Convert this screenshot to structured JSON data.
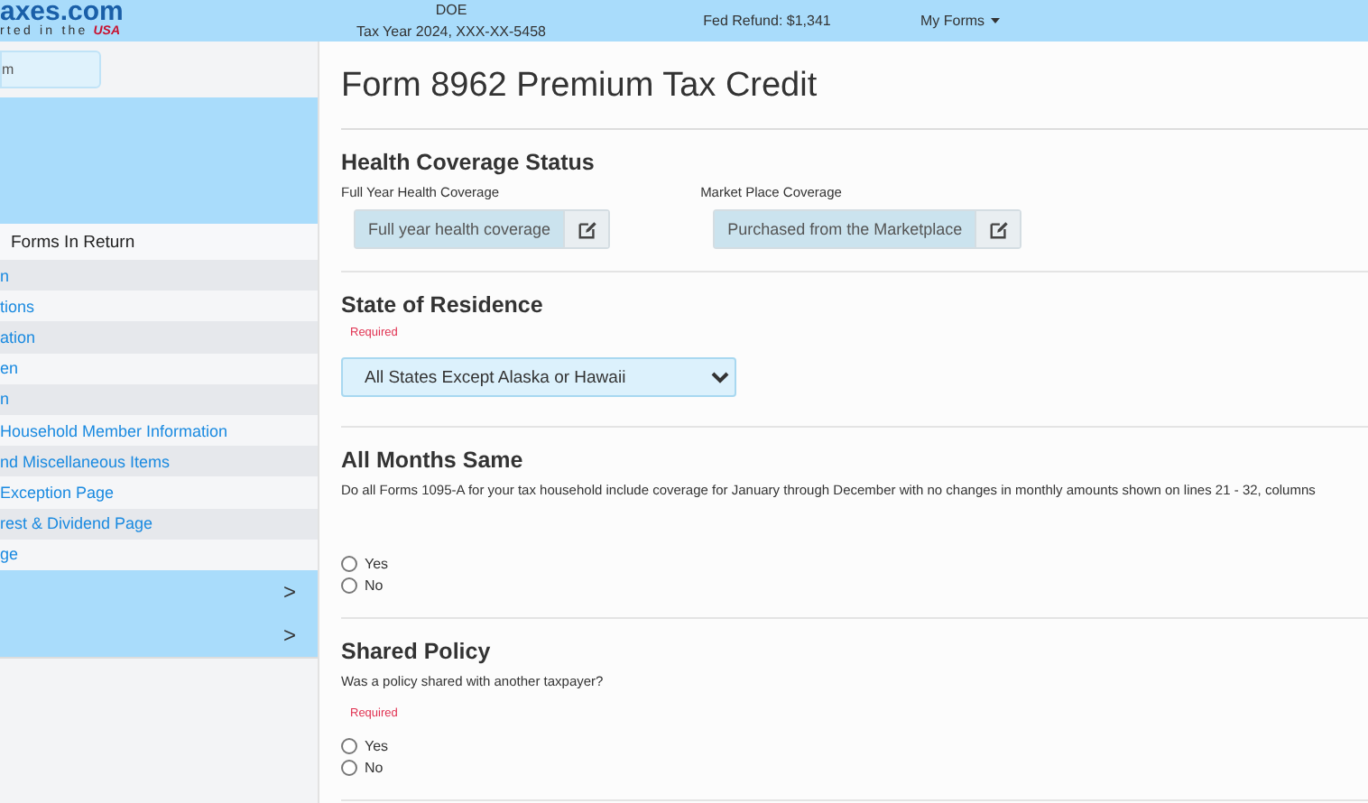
{
  "header": {
    "logo": "axes.com",
    "tagline": "rted in the",
    "tagline_flag": "USA",
    "name": "DOE",
    "tax_year": "Tax Year 2024, XXX-XX-5458",
    "refund": "Fed Refund: $1,341",
    "menu": "My Forms"
  },
  "sidebar": {
    "search": {
      "value": "m"
    },
    "heading": "Forms In Return",
    "items": [
      {
        "label": "n"
      },
      {
        "label": "tions"
      },
      {
        "label": "ation"
      },
      {
        "label": "en"
      },
      {
        "label": "n"
      },
      {
        "label": "Household Member Information"
      },
      {
        "label": "nd Miscellaneous Items"
      },
      {
        "label": "Exception Page"
      },
      {
        "label": "rest & Dividend Page"
      },
      {
        "label": "ge"
      }
    ],
    "expanders": [
      {
        "label": ">"
      },
      {
        "label": ">"
      }
    ]
  },
  "page": {
    "title": "Form 8962 Premium Tax Credit",
    "sections": [
      {
        "kind": "buttons",
        "title": "Health Coverage Status",
        "fields": [
          {
            "label": "Full Year Health Coverage",
            "value": "Full year health coverage"
          },
          {
            "label": "Market Place Coverage",
            "value": "Purchased from the Marketplace"
          }
        ]
      },
      {
        "kind": "select",
        "title": "State of Residence",
        "required": "Required",
        "value": "All States Except Alaska or Hawaii"
      },
      {
        "kind": "radio",
        "title": "All Months Same",
        "question": "Do all Forms 1095-A for your tax household include coverage for January through December with no changes in monthly amounts shown on lines 21 - 32, columns",
        "options": [
          {
            "label": "Yes",
            "checked": false
          },
          {
            "label": "No",
            "checked": false
          }
        ]
      },
      {
        "kind": "radio",
        "title": "Shared Policy",
        "question": "Was a policy shared with another taxpayer?",
        "required": "Required",
        "options": [
          {
            "label": "Yes",
            "checked": false
          },
          {
            "label": "No",
            "checked": false
          }
        ]
      }
    ]
  }
}
